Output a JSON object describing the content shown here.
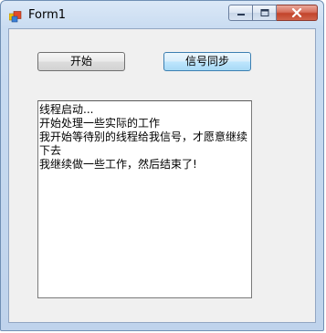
{
  "window": {
    "title": "Form1"
  },
  "buttons": {
    "start_label": "开始",
    "signal_label": "信号同步"
  },
  "log": {
    "lines": [
      "线程启动...",
      "开始处理一些实际的工作",
      "我开始等待别的线程给我信号，才愿意继续下去",
      "我继续做一些工作，然后结束了!"
    ]
  },
  "colors": {
    "close_button": "#c2442b",
    "focused_button_border": "#3c7fb1"
  },
  "icons": {
    "app": "winforms-app-icon",
    "minimize": "minimize-icon",
    "maximize": "maximize-icon",
    "close": "close-icon"
  }
}
